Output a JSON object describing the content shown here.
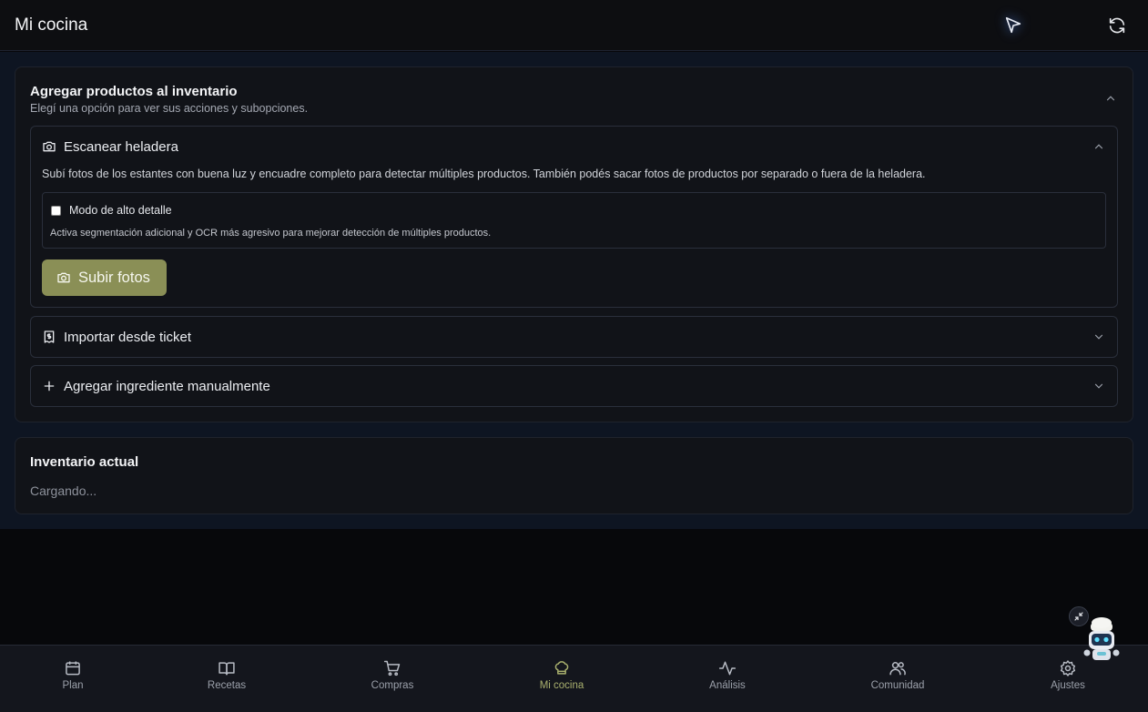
{
  "header": {
    "title": "Mi cocina",
    "cursor_icon": "cursor-arrow-icon",
    "sync_icon": "refresh-icon"
  },
  "add_card": {
    "title": "Agregar productos al inventario",
    "subtitle": "Elegí una opción para ver sus acciones y subopciones.",
    "sections": {
      "scan": {
        "title": "Escanear heladera",
        "icon": "camera-icon",
        "description": "Subí fotos de los estantes con buena luz y encuadre completo para detectar múltiples productos. También podés sacar fotos de productos por separado o fuera de la heladera.",
        "detail_mode_label": "Modo de alto detalle",
        "detail_mode_checked": false,
        "detail_mode_help": "Activa segmentación adicional y OCR más agresivo para mejorar detección de múltiples productos.",
        "upload_label": "Subir fotos"
      },
      "ticket": {
        "title": "Importar desde ticket",
        "icon": "receipt-icon"
      },
      "manual": {
        "title": "Agregar ingrediente manualmente",
        "icon": "plus-icon"
      }
    }
  },
  "inventory_card": {
    "title": "Inventario actual",
    "status": "Cargando..."
  },
  "nav": {
    "items": [
      {
        "label": "Plan",
        "icon": "calendar-icon"
      },
      {
        "label": "Recetas",
        "icon": "book-icon"
      },
      {
        "label": "Compras",
        "icon": "cart-icon"
      },
      {
        "label": "Mi cocina",
        "icon": "chef-hat-icon",
        "active": true
      },
      {
        "label": "Análisis",
        "icon": "activity-icon"
      },
      {
        "label": "Comunidad",
        "icon": "users-icon"
      },
      {
        "label": "Ajustes",
        "icon": "gear-icon"
      }
    ]
  },
  "colors": {
    "accent": "#8a8f56",
    "active_nav": "#a9b06e",
    "background": "#07080b",
    "panel": "#111318"
  }
}
